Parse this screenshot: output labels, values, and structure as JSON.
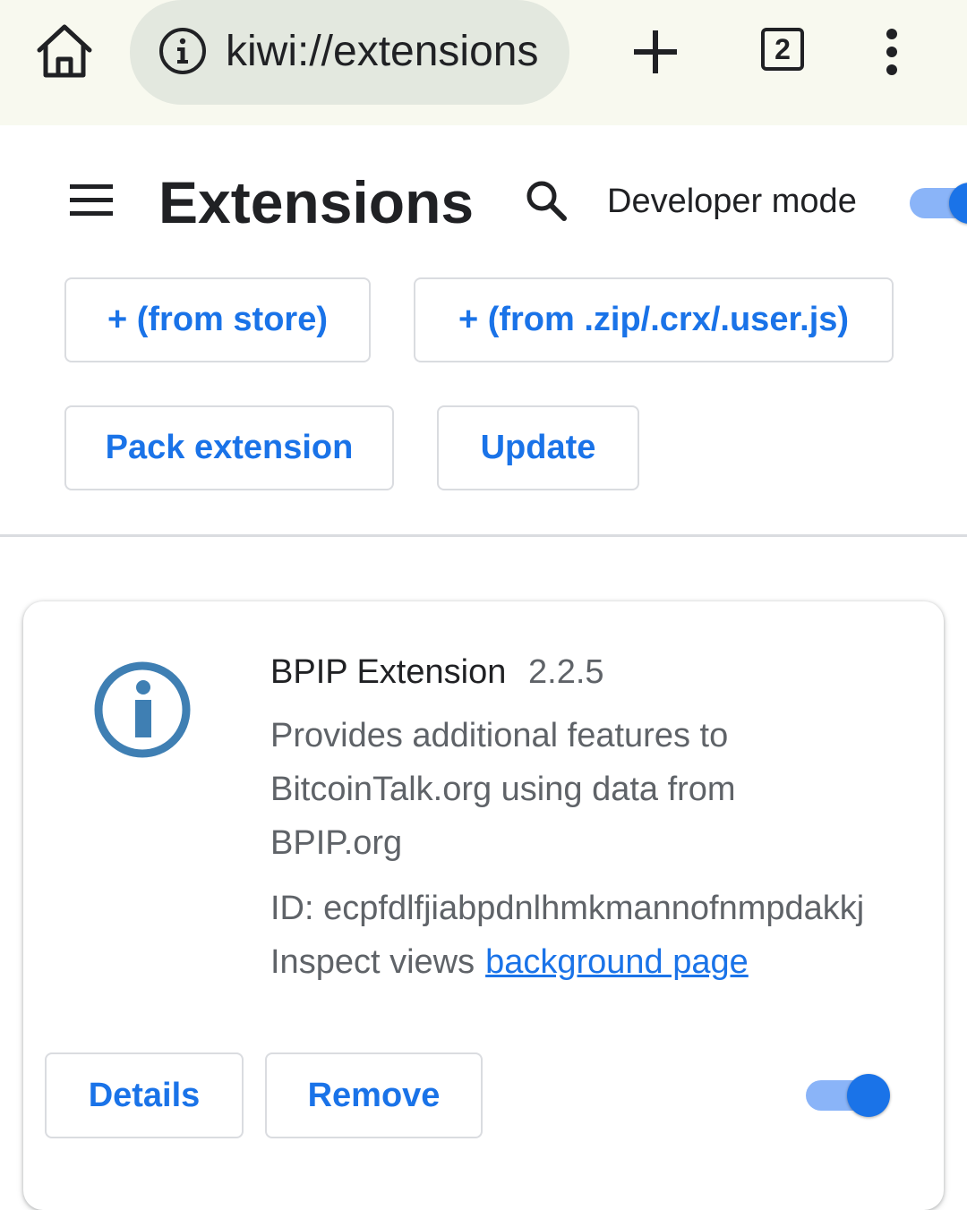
{
  "browser": {
    "url": "kiwi://extensions",
    "tab_count": "2"
  },
  "header": {
    "title": "Extensions",
    "developer_mode_label": "Developer mode",
    "developer_mode_on": true
  },
  "actions": {
    "from_store": "+ (from store)",
    "from_file": "+ (from .zip/.crx/.user.js)",
    "pack": "Pack extension",
    "update": "Update"
  },
  "extension": {
    "name": "BPIP Extension",
    "version": "2.2.5",
    "description": "Provides additional features to BitcoinTalk.org using data from BPIP.org",
    "id_text": "ID: ecpfdlfjiabpdnlhmkmannofnmpdakkj",
    "inspect_label": "Inspect views",
    "inspect_link": "background page",
    "details_label": "Details",
    "remove_label": "Remove",
    "enabled": true,
    "icon": "info-icon"
  },
  "colors": {
    "accent": "#1a73e8",
    "toggle_track": "#8ab4f8",
    "toolbar_bg": "#f8f9ef",
    "url_pill": "#e3e8df",
    "ext_icon": "#3f7fb3"
  }
}
